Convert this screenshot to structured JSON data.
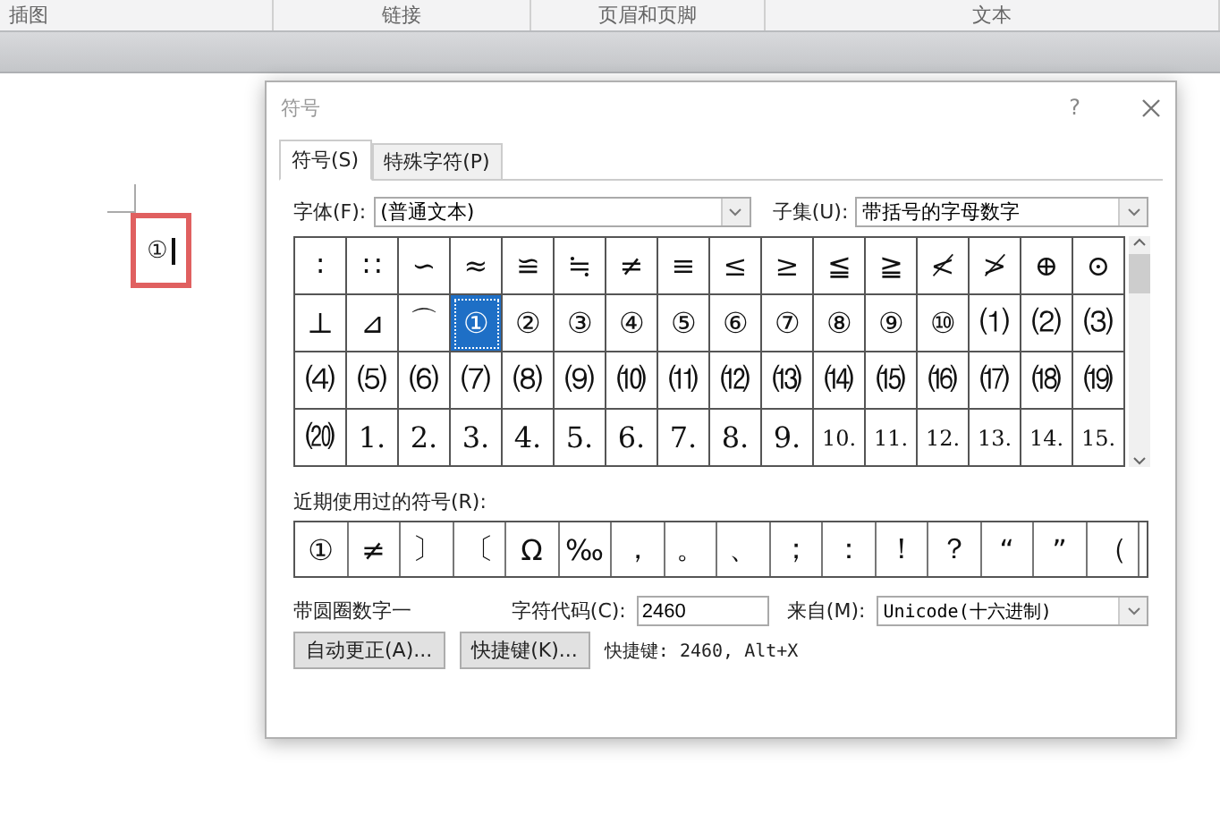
{
  "ribbon_groups": [
    "插图",
    "链接",
    "页眉和页脚",
    "文本"
  ],
  "document": {
    "text": "①"
  },
  "dialog": {
    "title": "符号",
    "help": "?",
    "tabs": [
      {
        "label": "符号(S)",
        "selected": true
      },
      {
        "label": "特殊字符(P)",
        "selected": false
      }
    ],
    "font": {
      "label": "字体(F):",
      "value": "(普通文本)"
    },
    "subset": {
      "label": "子集(U):",
      "value": "带括号的字母数字"
    },
    "symbols": [
      {
        "char": "∶",
        "selected": false
      },
      {
        "char": "∷",
        "selected": false
      },
      {
        "char": "∽",
        "selected": false
      },
      {
        "char": "≈",
        "selected": false
      },
      {
        "char": "≌",
        "selected": false
      },
      {
        "char": "≒",
        "selected": false
      },
      {
        "char": "≠",
        "selected": false
      },
      {
        "char": "≡",
        "selected": false
      },
      {
        "char": "≤",
        "selected": false
      },
      {
        "char": "≥",
        "selected": false
      },
      {
        "char": "≦",
        "selected": false
      },
      {
        "char": "≧",
        "selected": false
      },
      {
        "char": "≮",
        "selected": false
      },
      {
        "char": "≯",
        "selected": false
      },
      {
        "char": "⊕",
        "selected": false
      },
      {
        "char": "⊙",
        "selected": false
      },
      {
        "char": "⊥",
        "selected": false
      },
      {
        "char": "⊿",
        "selected": false
      },
      {
        "char": "⌒",
        "selected": false
      },
      {
        "char": "①",
        "selected": true
      },
      {
        "char": "②",
        "selected": false
      },
      {
        "char": "③",
        "selected": false
      },
      {
        "char": "④",
        "selected": false
      },
      {
        "char": "⑤",
        "selected": false
      },
      {
        "char": "⑥",
        "selected": false
      },
      {
        "char": "⑦",
        "selected": false
      },
      {
        "char": "⑧",
        "selected": false
      },
      {
        "char": "⑨",
        "selected": false
      },
      {
        "char": "⑩",
        "selected": false
      },
      {
        "char": "⑴",
        "selected": false
      },
      {
        "char": "⑵",
        "selected": false
      },
      {
        "char": "⑶",
        "selected": false
      },
      {
        "char": "⑷",
        "selected": false
      },
      {
        "char": "⑸",
        "selected": false
      },
      {
        "char": "⑹",
        "selected": false
      },
      {
        "char": "⑺",
        "selected": false
      },
      {
        "char": "⑻",
        "selected": false
      },
      {
        "char": "⑼",
        "selected": false
      },
      {
        "char": "⑽",
        "selected": false
      },
      {
        "char": "⑾",
        "selected": false
      },
      {
        "char": "⑿",
        "selected": false
      },
      {
        "char": "⒀",
        "selected": false
      },
      {
        "char": "⒁",
        "selected": false
      },
      {
        "char": "⒂",
        "selected": false
      },
      {
        "char": "⒃",
        "selected": false
      },
      {
        "char": "⒄",
        "selected": false
      },
      {
        "char": "⒅",
        "selected": false
      },
      {
        "char": "⒆",
        "selected": false
      },
      {
        "char": "⒇",
        "selected": false
      },
      {
        "char": "1.",
        "selected": false
      },
      {
        "char": "2.",
        "selected": false
      },
      {
        "char": "3.",
        "selected": false
      },
      {
        "char": "4.",
        "selected": false
      },
      {
        "char": "5.",
        "selected": false
      },
      {
        "char": "6.",
        "selected": false
      },
      {
        "char": "7.",
        "selected": false
      },
      {
        "char": "8.",
        "selected": false
      },
      {
        "char": "9.",
        "selected": false
      },
      {
        "char": "10.",
        "selected": false
      },
      {
        "char": "11.",
        "selected": false
      },
      {
        "char": "12.",
        "selected": false
      },
      {
        "char": "13.",
        "selected": false
      },
      {
        "char": "14.",
        "selected": false
      },
      {
        "char": "15.",
        "selected": false
      }
    ],
    "recent_label": "近期使用过的符号(R):",
    "recent": [
      "①",
      "≠",
      "〕",
      "〔",
      "Ω",
      "‰",
      "，",
      "。",
      "、",
      "；",
      "：",
      "！",
      "？",
      "“",
      "”",
      "（"
    ],
    "char_name": "带圆圈数字一",
    "code": {
      "label": "字符代码(C):",
      "value": "2460"
    },
    "from": {
      "label": "来自(M):",
      "value": "Unicode(十六进制)"
    },
    "buttons": [
      "自动更正(A)...",
      "快捷键(K)..."
    ],
    "shortcut": "快捷键: 2460, Alt+X"
  }
}
